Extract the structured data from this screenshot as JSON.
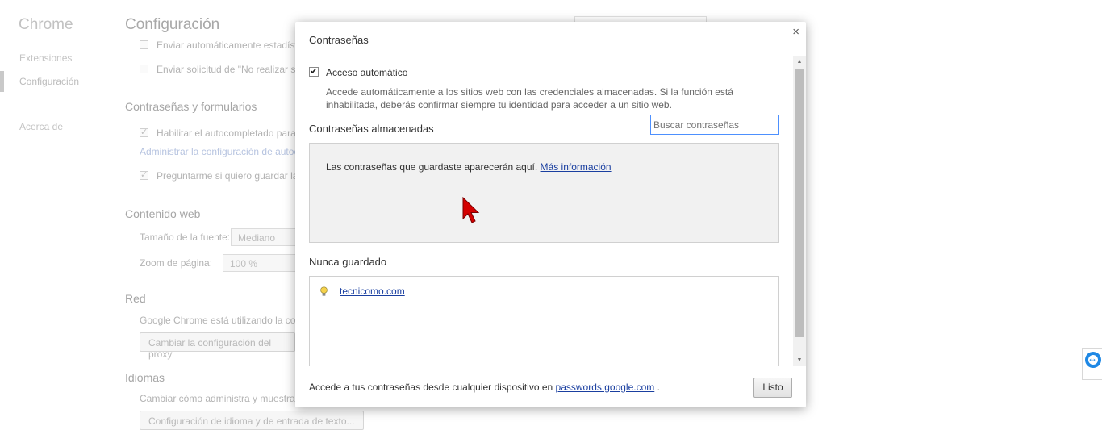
{
  "background": {
    "brand": "Chrome",
    "nav": [
      "Extensiones",
      "Configuración",
      "Acerca de"
    ],
    "page_title": "Configuración",
    "rows": {
      "stats": "Enviar automáticamente estadíst",
      "dnt": "Enviar solicitud de \"No realizar se",
      "autofill": "Habilitar el autocompletado para",
      "autofill_link": "Administrar la configuración de autoc",
      "offer_save": "Preguntarme si quiero guardar la"
    },
    "sections": {
      "passwords": "Contraseñas y formularios",
      "web": "Contenido web",
      "network": "Red",
      "languages": "Idiomas"
    },
    "font_size_label": "Tamaño de la fuente:",
    "font_size_value": "Mediano",
    "zoom_label": "Zoom de página:",
    "zoom_value": "100 %",
    "network_text": "Google Chrome está utilizando la co",
    "proxy_button": "Cambiar la configuración del proxy",
    "lang_text": "Cambiar cómo administra y muestra",
    "lang_button": "Configuración de idioma y de entrada de texto..."
  },
  "dialog": {
    "title": "Contraseñas",
    "close_glyph": "×",
    "auto_signin_label": "Acceso automático",
    "auto_signin_checked": true,
    "auto_signin_desc": "Accede automáticamente a los sitios web con las credenciales almacenadas. Si la función está inhabilitada, deberás confirmar siempre tu identidad para acceder a un sitio web.",
    "saved_heading": "Contraseñas almacenadas",
    "search_placeholder": "Buscar contraseñas",
    "saved_empty_text": "Las contraseñas que guardaste aparecerán aquí.",
    "more_info_link": "Más información",
    "never_heading": "Nunca guardado",
    "never_sites": [
      "tecnicomo.com"
    ],
    "footer_text": "Accede a tus contraseñas desde cualquier dispositivo en",
    "footer_link": "passwords.google.com",
    "footer_period": ".",
    "done_button": "Listo"
  },
  "colors": {
    "accent": "#4d90fe",
    "link": "#1a3fa0",
    "cursor": "#d40000",
    "teamviewer": "#1e88e5"
  },
  "icons": [
    "close-icon",
    "checkbox-check-icon",
    "site-favicon-icon",
    "scroll-up-icon",
    "scroll-down-icon",
    "mouse-cursor-icon",
    "teamviewer-icon"
  ]
}
